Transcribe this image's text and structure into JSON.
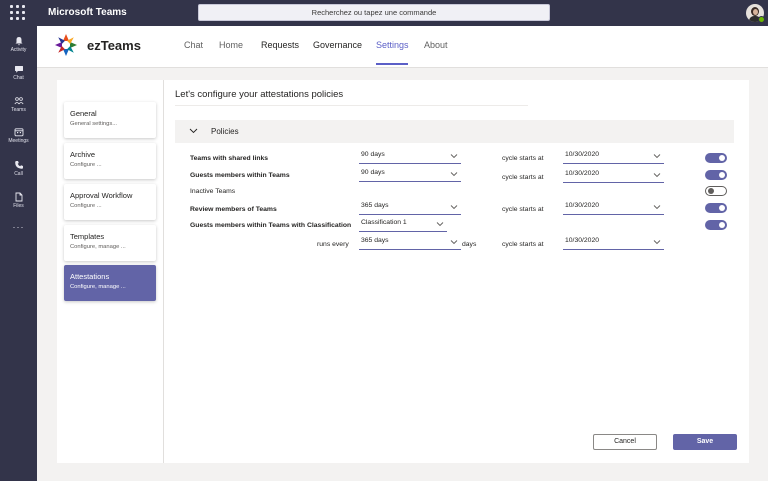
{
  "app": {
    "title": "Microsoft Teams",
    "search_placeholder": "Recherchez ou tapez une commande"
  },
  "rail": [
    {
      "label": "Activity",
      "icon": "bell-icon"
    },
    {
      "label": "Chat",
      "icon": "chat-icon"
    },
    {
      "label": "Teams",
      "icon": "teams-icon"
    },
    {
      "label": "Meetings",
      "icon": "calendar-icon"
    },
    {
      "label": "Call",
      "icon": "phone-icon"
    },
    {
      "label": "Files",
      "icon": "file-icon"
    }
  ],
  "rail_more": "···",
  "header": {
    "brand": "ezTeams",
    "tabs": [
      {
        "label": "Chat",
        "active": false
      },
      {
        "label": "Home",
        "active": false
      },
      {
        "label": "Requests",
        "active": false
      },
      {
        "label": "Governance",
        "active": false
      },
      {
        "label": "Settings",
        "active": true
      },
      {
        "label": "About",
        "active": false
      }
    ]
  },
  "menu": [
    {
      "title": "General",
      "subtitle": "General settings..."
    },
    {
      "title": "Archive",
      "subtitle": "Configure ..."
    },
    {
      "title": "Approval Workflow",
      "subtitle": "Configure ..."
    },
    {
      "title": "Templates",
      "subtitle": "Configure, manage ..."
    },
    {
      "title": "Attestations",
      "subtitle": "Configure, manage ...",
      "active": true
    }
  ],
  "main": {
    "title": "Let's configure your attestations policies",
    "section_label": "Policies",
    "cycle_label": "cycle starts at",
    "runs_every_label": "runs every",
    "days_label": "days",
    "rows": [
      {
        "label": "Teams with shared links",
        "duration": "90 days",
        "date": "10/30/2020",
        "enabled": true
      },
      {
        "label": "Guests members within Teams",
        "duration": "90 days",
        "date": "10/30/2020",
        "enabled": true
      },
      {
        "label": "Inactive Teams",
        "enabled": false
      },
      {
        "label": "Review members of Teams",
        "duration": "365 days",
        "date": "10/30/2020",
        "enabled": true
      },
      {
        "label": "Guests members within Teams with Classification",
        "classification": "Classification 1",
        "enabled": true
      }
    ],
    "extra": {
      "duration": "365 days",
      "date": "10/30/2020"
    },
    "cancel_label": "Cancel",
    "save_label": "Save"
  },
  "colors": {
    "accent": "#6264a7",
    "rail": "#33344a",
    "active_tab": "#5b5fc7"
  }
}
